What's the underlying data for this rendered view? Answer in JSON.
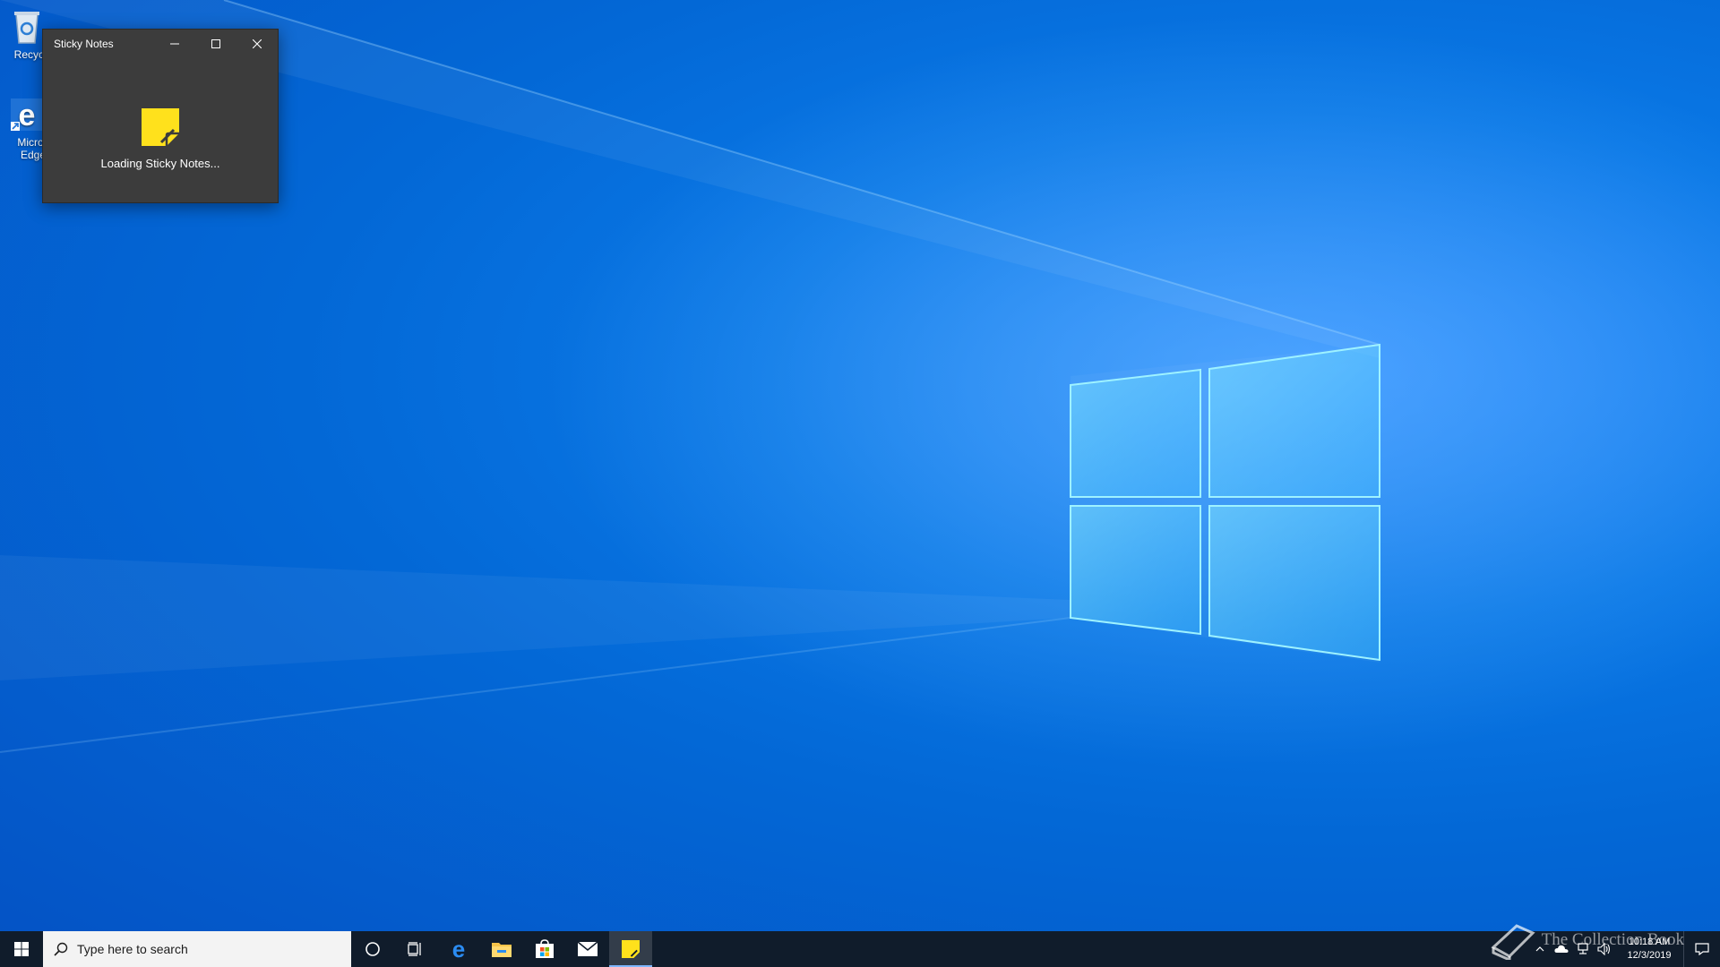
{
  "desktop": {
    "icons": [
      {
        "label": "Recycle",
        "icon": "recycle-bin-icon"
      },
      {
        "label": "Micros\nEdge",
        "icon": "edge-icon"
      }
    ],
    "colors": {
      "accent": "#0a78e6",
      "logo_glow": "#9ef2ff"
    }
  },
  "sticky_window": {
    "title": "Sticky Notes",
    "loading_text": "Loading Sticky Notes...",
    "app_icon": "sticky-notes-icon",
    "icon_color": "#ffe11c"
  },
  "taskbar": {
    "search_placeholder": "Type here to search",
    "pinned": [
      "cortana-icon",
      "task-view-icon",
      "edge-icon",
      "file-explorer-icon",
      "store-icon",
      "mail-icon",
      "sticky-notes-icon"
    ],
    "active": "sticky-notes-icon",
    "clock_time": "10:18 AM",
    "clock_date": "12/3/2019",
    "watermark": "The Collection Book"
  }
}
